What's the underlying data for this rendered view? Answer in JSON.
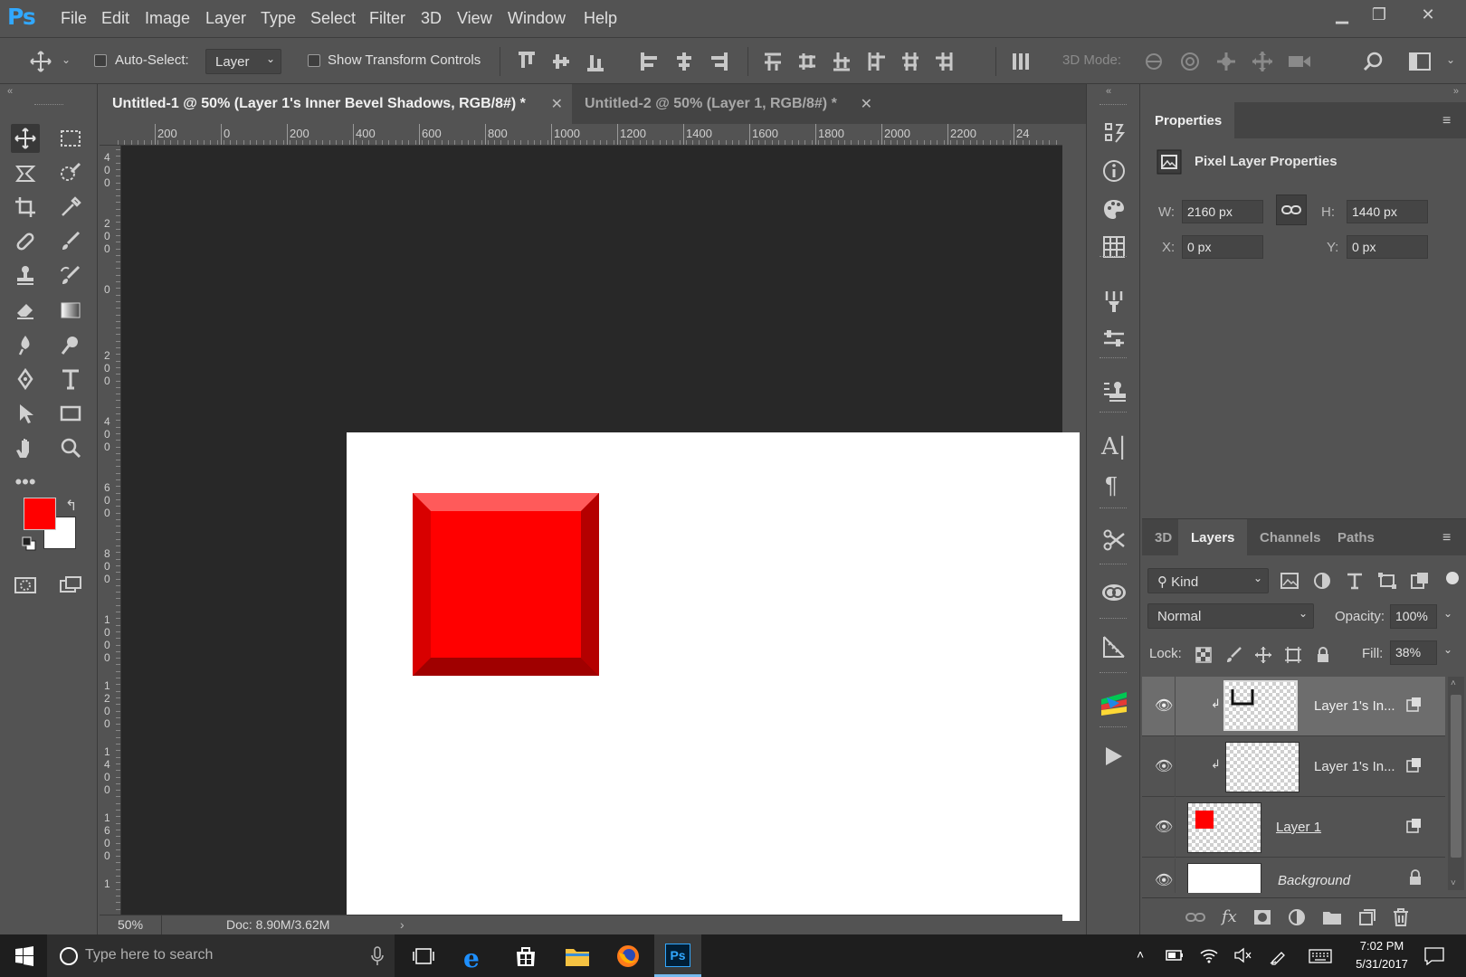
{
  "app": {
    "logo": "Ps"
  },
  "menu": [
    "File",
    "Edit",
    "Image",
    "Layer",
    "Type",
    "Select",
    "Filter",
    "3D",
    "View",
    "Window",
    "Help"
  ],
  "options": {
    "auto_select_label": "Auto-Select:",
    "auto_select_value": "Layer",
    "show_transform_label": "Show Transform Controls",
    "mode_3d_label": "3D Mode:"
  },
  "tabs": [
    {
      "label": "Untitled-1 @ 50% (Layer 1's Inner Bevel Shadows, RGB/8#) *",
      "active": true
    },
    {
      "label": "Untitled-2 @ 50% (Layer 1, RGB/8#) *",
      "active": false
    }
  ],
  "rulers": {
    "h": [
      "200",
      "0",
      "200",
      "400",
      "600",
      "800",
      "1000",
      "1200",
      "1400",
      "1600",
      "1800",
      "2000",
      "2200",
      "24"
    ],
    "v": [
      "4 0 0",
      "2 0 0",
      "0",
      "2 0 0",
      "4 0 0",
      "6 0 0",
      "8 0 0",
      "1 0 0 0",
      "1 2 0 0",
      "1 4 0 0",
      "1 6 0 0",
      "1"
    ]
  },
  "status": {
    "zoom": "50%",
    "doc": "Doc: 8.90M/3.62M"
  },
  "colors": {
    "foreground": "#ff0000",
    "background": "#ffffff",
    "accent": "#31a8ff"
  },
  "properties": {
    "tab": "Properties",
    "title": "Pixel Layer Properties",
    "w_label": "W:",
    "w_value": "2160 px",
    "h_label": "H:",
    "h_value": "1440 px",
    "x_label": "X:",
    "x_value": "0 px",
    "y_label": "Y:",
    "y_value": "0 px"
  },
  "layers_panel": {
    "tabs": [
      "3D",
      "Layers",
      "Channels",
      "Paths"
    ],
    "active_tab": "Layers",
    "filter": "Kind",
    "blend_mode": "Normal",
    "opacity_label": "Opacity:",
    "opacity_value": "100%",
    "lock_label": "Lock:",
    "fill_label": "Fill:",
    "fill_value": "38%",
    "layers": [
      {
        "name": "Layer 1's In...",
        "selected": true
      },
      {
        "name": "Layer 1's In...",
        "selected": false
      },
      {
        "name": "Layer 1",
        "selected": false
      },
      {
        "name": "Background",
        "selected": false
      }
    ]
  },
  "taskbar": {
    "search_placeholder": "Type here to search",
    "time": "7:02 PM",
    "date": "5/31/2017"
  }
}
